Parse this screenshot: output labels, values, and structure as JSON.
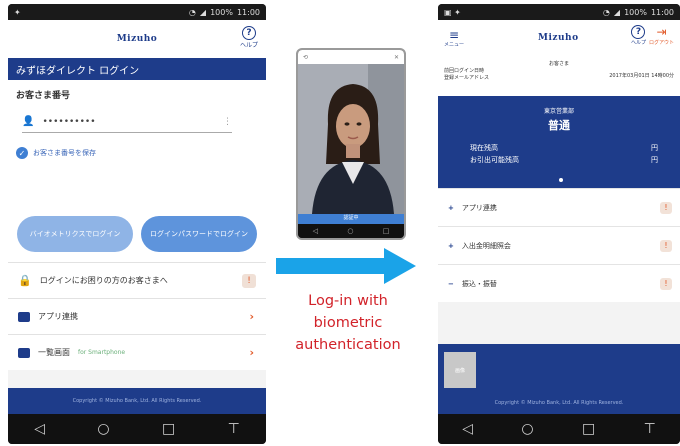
{
  "caption": {
    "line1": "Log-in with",
    "line2": "biometric",
    "line3": "authentication"
  },
  "colors": {
    "brand_navy": "#1e3c8a",
    "accent_blue": "#3f7fd3",
    "caption_red": "#d2232a",
    "arrow_blue": "#1aa3e8",
    "alert_orange": "#e25a2a"
  },
  "statusbar": {
    "time": "11:00",
    "battery": "100%"
  },
  "login_screen": {
    "logo": "Mizuho",
    "help_label": "ヘルプ",
    "title": "みずほダイレクト ログイン",
    "customer_number_label": "お客さま番号",
    "customer_number_value": "••••••••••",
    "remember_label": "お客さま番号を保存",
    "biometric_button": "バイオメトリクスでログイン",
    "password_button": "ログインパスワードでログイン",
    "menu": [
      {
        "label": "ログインにお困りの方のお客さまへ",
        "icon": "lock-icon",
        "marker": "!"
      },
      {
        "label": "アプリ連携",
        "icon": "card-icon",
        "marker": "›"
      },
      {
        "label": "一覧画面",
        "icon": "card-icon",
        "tag": "for Smartphone",
        "marker": "›"
      }
    ],
    "footer": "Copyright © Mizuho Bank, Ltd. All Rights Reserved."
  },
  "camera_screen": {
    "bar_label": "認証中"
  },
  "account_screen": {
    "menu_label": "メニュー",
    "logo": "Mizuho",
    "help_label": "ヘルプ",
    "logout_label": "ログアウト",
    "greeting": "お客さま",
    "last_login_label": "前回ログイン日時",
    "email_label": "登録メールアドレス",
    "last_login_value": "2017年03月01日 14時00分",
    "account_label": "東京営業部",
    "account_type": "普通",
    "balance_label": "現在残高",
    "available_label": "お引出可能残高",
    "balance_value": "円",
    "available_value": "円",
    "rows": [
      {
        "label": "アプリ連携",
        "marker": "!"
      },
      {
        "label": "入出金明細照会",
        "marker": "!"
      },
      {
        "label": "振込・振替",
        "marker": "!"
      }
    ],
    "thumb_label": "画像",
    "footer": "Copyright © Mizuho Bank, Ltd. All Rights Reserved."
  },
  "nav": {
    "back": "◁",
    "home": "○",
    "recent": "□",
    "extra": "⊤"
  }
}
